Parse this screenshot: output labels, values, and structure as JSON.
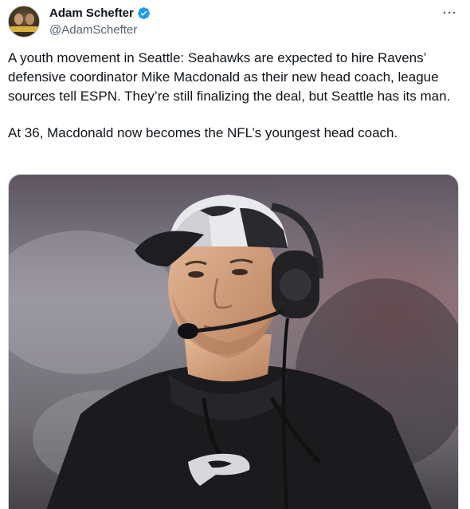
{
  "author": {
    "display_name": "Adam Schefter",
    "handle": "@AdamSchefter",
    "avatar_icon": "profile-photo",
    "verified_icon": "verified-badge-icon",
    "verified_color": "#1d9bf0"
  },
  "more_menu": {
    "label": "···",
    "icon": "more-options-icon"
  },
  "tweet": {
    "paragraph_1": "A youth movement in Seattle: Seahawks are expected to hire Ravens’ defensive coordinator Mike Macdonald as their new head coach, league sources tell ESPN. They’re still finalizing the deal, but Seattle has its man.",
    "paragraph_2": "At 36, Macdonald now becomes the NFL’s youngest head coach."
  },
  "media": {
    "image_icon": "coach-photo"
  },
  "colors": {
    "text": "#0f1419",
    "secondary": "#536471",
    "border": "#cfd9de"
  }
}
